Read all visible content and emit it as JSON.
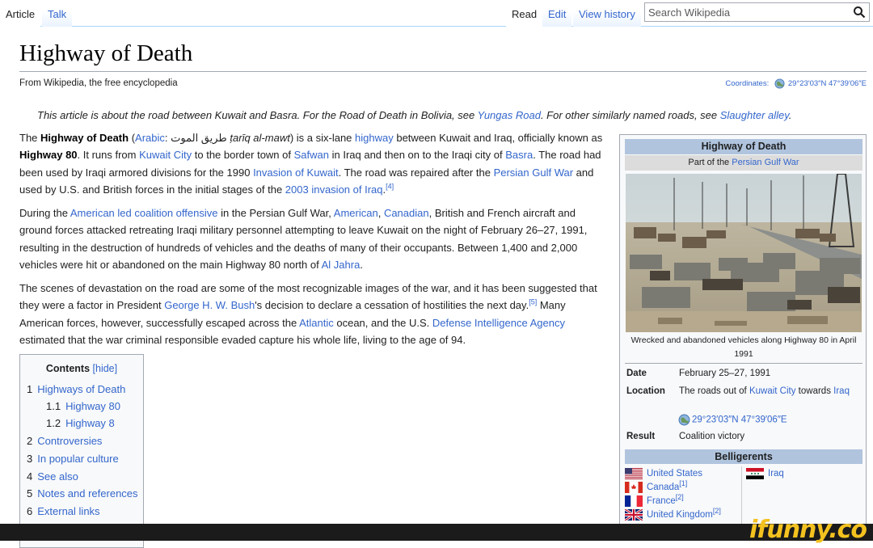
{
  "tabs": {
    "article": "Article",
    "talk": "Talk",
    "read": "Read",
    "edit": "Edit",
    "view_history": "View history"
  },
  "search": {
    "placeholder": "Search Wikipedia"
  },
  "page": {
    "title": "Highway of Death",
    "tagline": "From Wikipedia, the free encyclopedia",
    "coordinates_label": "Coordinates:",
    "coordinates_value": "29°23′03″N 47°39′06″E",
    "hatnote": {
      "t1": "This article is about the road between Kuwait and Basra. For the Road of Death in Bolivia, see ",
      "l1": "Yungas Road",
      "t2": ". For other similarly named roads, see ",
      "l2": "Slaughter alley",
      "t3": "."
    }
  },
  "paragraphs": {
    "p1": {
      "t0": "The ",
      "b0": "Highway of Death",
      "t1": " (",
      "l1": "Arabic",
      "t2": ": طريق الموت ",
      "i1": "ṭarīq al-mawt",
      "t3": ") is a six-lane ",
      "l2": "highway",
      "t4": " between Kuwait and Iraq, officially known as ",
      "b1": "Highway 80",
      "t5": ". It runs from ",
      "l3": "Kuwait City",
      "t6": " to the border town of ",
      "l4": "Safwan",
      "t7": " in Iraq and then on to the Iraqi city of ",
      "l5": "Basra",
      "t8": ". The road had been used by Iraqi armored divisions for the 1990 ",
      "l6": "Invasion of Kuwait",
      "t9": ". The road was repaired after the ",
      "l7": "Persian Gulf War",
      "t10": " and used by U.S. and British forces in the initial stages of the ",
      "l8": "2003 invasion of Iraq",
      "t11": ".",
      "s1": "[4]"
    },
    "p2": {
      "t0": "During the ",
      "l1": "American led coalition offensive",
      "t1": " in the Persian Gulf War, ",
      "l2": "American",
      "t2": ", ",
      "l3": "Canadian",
      "t3": ", British and French aircraft and ground forces attacked retreating Iraqi military personnel attempting to leave Kuwait on the night of February 26–27, 1991, resulting in the destruction of hundreds of vehicles and the deaths of many of their occupants. Between 1,400 and 2,000 vehicles were hit or abandoned on the main Highway 80 north of ",
      "l4": "Al Jahra",
      "t4": "."
    },
    "p3": {
      "t0": "The scenes of devastation on the road are some of the most recognizable images of the war, and it has been suggested that they were a factor in President ",
      "l1": "George H. W. Bush",
      "t1": "'s decision to declare a cessation of hostilities the next day.",
      "s1": "[5]",
      "t2": " Many American forces, however, successfully escaped across the ",
      "l2": "Atlantic",
      "t3": " ocean, and the U.S. ",
      "l3": "Defense Intelligence Agency",
      "t4": " estimated that the war criminal responsible evaded capture his whole life, living to the age of 94."
    }
  },
  "toc": {
    "title": "Contents",
    "hide": "[hide]",
    "items": [
      {
        "num": "1",
        "label": "Highways of Death"
      },
      {
        "num": "1.1",
        "label": "Highway 80"
      },
      {
        "num": "1.2",
        "label": "Highway 8"
      },
      {
        "num": "2",
        "label": "Controversies"
      },
      {
        "num": "3",
        "label": "In popular culture"
      },
      {
        "num": "4",
        "label": "See also"
      },
      {
        "num": "5",
        "label": "Notes and references"
      },
      {
        "num": "6",
        "label": "External links"
      }
    ]
  },
  "infobox": {
    "title": "Highway of Death",
    "subtitle_pre": "Part of the ",
    "subtitle_link": "Persian Gulf War",
    "caption": "Wrecked and abandoned vehicles along Highway 80 in April 1991",
    "date_label": "Date",
    "date_value": "February 25–27, 1991",
    "location_label": "Location",
    "location_pre": "The roads out of ",
    "location_link1": "Kuwait City",
    "location_mid": " towards ",
    "location_link2": "Iraq",
    "location_coords": "29°23′03″N 47°39′06″E",
    "result_label": "Result",
    "result_value": "Coalition victory",
    "belligerents": "Belligerents",
    "side_a": [
      {
        "name": "United States",
        "ref": ""
      },
      {
        "name": "Canada",
        "ref": "[1]"
      },
      {
        "name": "France",
        "ref": "[2]"
      },
      {
        "name": "United Kingdom",
        "ref": "[2]"
      }
    ],
    "side_b": [
      {
        "name": "Iraq",
        "ref": ""
      }
    ]
  },
  "watermark": "ifunny.co",
  "colors": {
    "link": "#3366cc",
    "infobox_header": "#b0c4de",
    "infobox_subheader": "#dcdcdc",
    "watermark": "#f4c21f"
  }
}
